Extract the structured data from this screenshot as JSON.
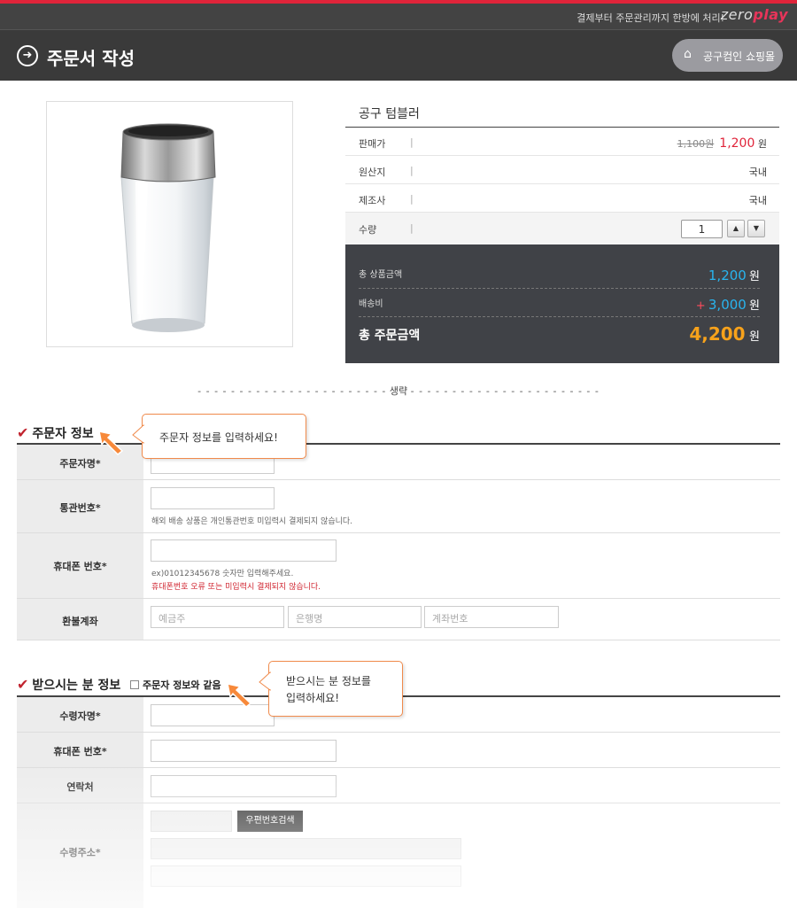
{
  "topbar": {
    "tagline": "결제부터 주문관리까지 한방에 처리!",
    "logo_main": "zero",
    "logo_accent": "play"
  },
  "header": {
    "title": "주문서 작성",
    "shop_button": "공구컴인 쇼핑몰"
  },
  "product": {
    "name": "공구 텀블러",
    "sale_label": "판매가",
    "old_price": "1,100원",
    "price": "1,200",
    "price_unit": "원",
    "origin_label": "원산지",
    "origin": "국내",
    "maker_label": "제조사",
    "maker": "국내",
    "qty_label": "수량",
    "qty": "1",
    "sep": "|"
  },
  "totals": {
    "goods_label": "총 상품금액",
    "goods_amount": "1,200",
    "ship_label": "배송비",
    "ship_plus": "+",
    "ship_amount": "3,000",
    "total_label": "총 주문금액",
    "total_amount": "4,200",
    "unit": "원"
  },
  "omitted": "생략",
  "orderer": {
    "title": "주문자 정보",
    "bubble": "주문자 정보를 입력하세요!",
    "name_label": "주문자명*",
    "customs_label": "통관번호*",
    "customs_hint": "해외 배송 상품은 개인통관번호 미입력시 결제되지 않습니다.",
    "phone_label": "휴대폰 번호*",
    "phone_hint": "ex)01012345678 숫자만 입력해주세요.",
    "phone_warn": "휴대폰번호 오류 또는 미입력시 결제되지 않습니다.",
    "refund_label": "환불계좌",
    "holder_ph": "예금주",
    "bank_ph": "은행명",
    "account_ph": "계좌번호"
  },
  "receiver": {
    "title": "받으시는 분 정보",
    "same_label": "주문자 정보와 같음",
    "bubble_l1": "받으시는 분 정보를",
    "bubble_l2": "입력하세요!",
    "name_label": "수령자명*",
    "phone_label": "휴대폰 번호*",
    "contact_label": "연락처",
    "addr_label": "수령주소*",
    "zip_button": "우편번호검색"
  },
  "colors": {
    "accent_red": "#e0243a",
    "blue": "#29b4ee",
    "orange": "#f7a21b",
    "header_bg": "#3a3a3a"
  }
}
